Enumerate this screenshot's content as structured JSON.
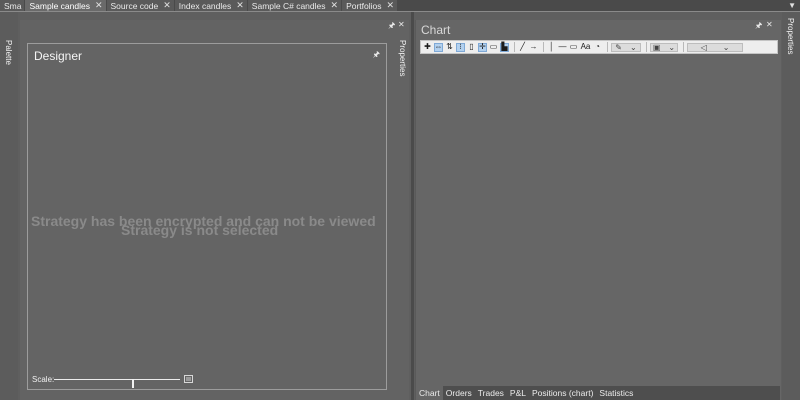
{
  "tabs": [
    {
      "label": "Sma",
      "active": false
    },
    {
      "label": "Sample candles",
      "active": true
    },
    {
      "label": "Source code",
      "active": false
    },
    {
      "label": "Index candles",
      "active": false
    },
    {
      "label": "Sample C# candles",
      "active": false
    },
    {
      "label": "Portfolios",
      "active": false
    }
  ],
  "tab_close_glyph": "✕",
  "tab_menu_glyph": "▼",
  "left_strip": {
    "label": "Palette"
  },
  "left_properties": {
    "label": "Properties"
  },
  "right_properties": {
    "label": "Properties"
  },
  "designer": {
    "title": "Designer",
    "encrypted_message": "Strategy has been encrypted and can not be viewed",
    "not_selected_message": "Strategy is not selected",
    "scale_label": "Scale:",
    "scale_value": 0.62
  },
  "chart": {
    "title": "Chart",
    "toolbar": [
      {
        "icon": "crosshair-move-icon",
        "glyph": "✚",
        "selected": false
      },
      {
        "icon": "pan-horizontal-icon",
        "glyph": "⇔",
        "selected": true
      },
      {
        "icon": "sort-arrows-icon",
        "glyph": "⇅",
        "selected": false
      },
      {
        "icon": "vertical-range-icon",
        "glyph": "⁝",
        "selected": true
      },
      {
        "icon": "document-icon",
        "glyph": "▯",
        "selected": false
      },
      {
        "icon": "crosshair-icon",
        "glyph": "✛",
        "selected": true
      },
      {
        "icon": "annotation-icon",
        "glyph": "▭",
        "selected": false
      },
      {
        "icon": "layout-icon",
        "glyph": "▙",
        "selected": true
      },
      {
        "icon": "line-icon",
        "glyph": "╱",
        "selected": false
      },
      {
        "icon": "arrow-icon",
        "glyph": "→",
        "selected": false
      },
      {
        "icon": "vertical-line-icon",
        "glyph": "│",
        "selected": false
      },
      {
        "icon": "horizontal-line-icon",
        "glyph": "—",
        "selected": false
      },
      {
        "icon": "rectangle-icon",
        "glyph": "▭",
        "selected": false
      },
      {
        "icon": "text-icon",
        "glyph": "Aa",
        "selected": false
      },
      {
        "icon": "gauge-icon",
        "glyph": "◔",
        "selected": false
      }
    ],
    "bottom_tabs": [
      {
        "label": "Chart",
        "active": true
      },
      {
        "label": "Orders",
        "active": false
      },
      {
        "label": "Trades",
        "active": false
      },
      {
        "label": "P&L",
        "active": false
      },
      {
        "label": "Positions (chart)",
        "active": false
      },
      {
        "label": "Statistics",
        "active": false
      }
    ]
  },
  "pane_pin_glyph": "🖈",
  "pane_close_glyph": "✕",
  "colors": {
    "accent": "#b3d1ef",
    "background": "#5f5f5f",
    "muted_text": "#8a8a8a"
  }
}
